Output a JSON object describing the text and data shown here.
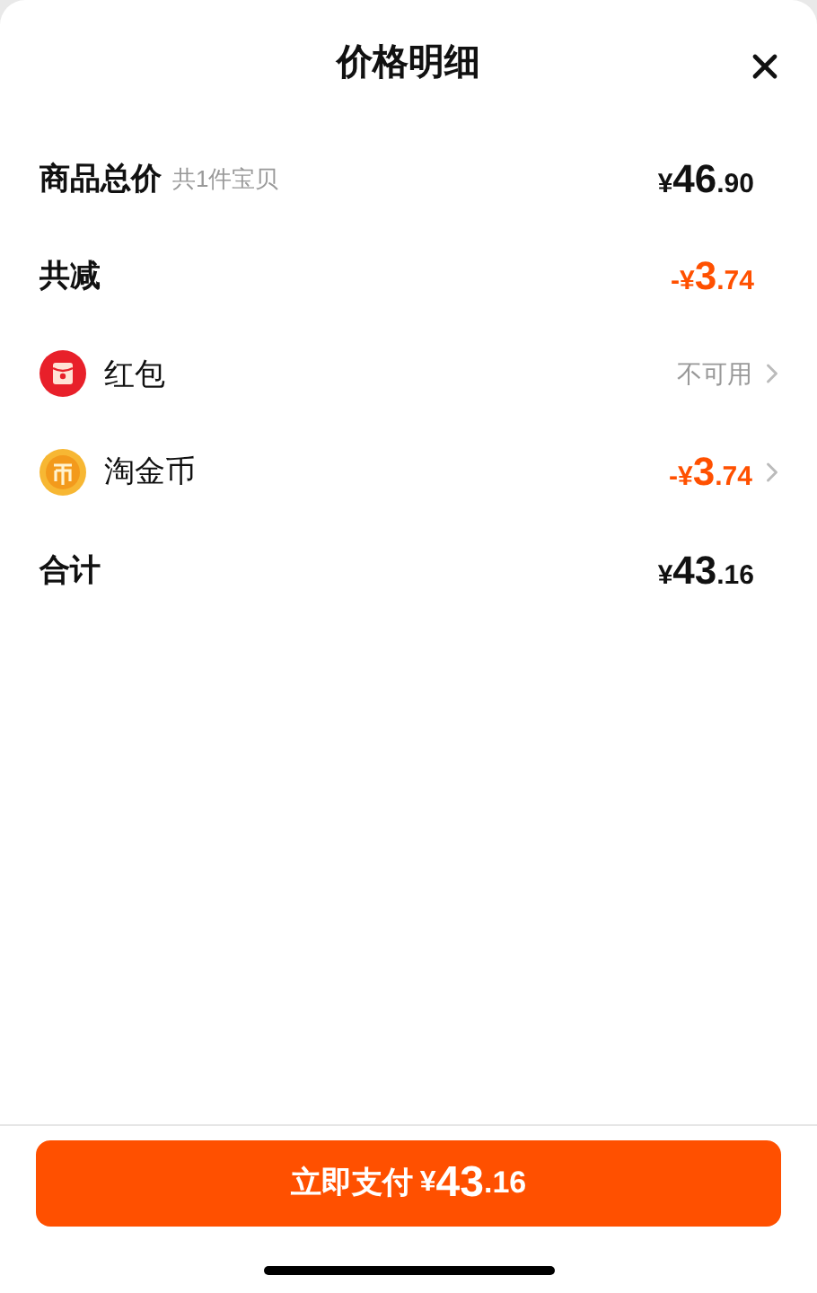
{
  "sheet": {
    "title": "价格明细"
  },
  "rows": [
    {
      "kind": "plain",
      "label": "商品总价",
      "note": "共1件宝贝",
      "amount": {
        "color": "#111111",
        "prefix": "¥",
        "integer": "46",
        "fraction": ".90"
      }
    },
    {
      "kind": "plain",
      "label": "共减",
      "amount": {
        "color": "#ff5000",
        "prefix": "-¥",
        "integer": "3",
        "fraction": ".74"
      }
    },
    {
      "kind": "envelope",
      "label": "红包",
      "status": "不可用"
    },
    {
      "kind": "coin",
      "label": "淘金币",
      "amount": {
        "color": "#ff5000",
        "prefix": "-¥",
        "integer": "3",
        "fraction": ".74"
      }
    },
    {
      "kind": "plain",
      "label": "合计",
      "amount": {
        "color": "#111111",
        "prefix": "¥",
        "integer": "43",
        "fraction": ".16"
      }
    }
  ],
  "pay_button": {
    "label": "立即支付",
    "prefix": "¥",
    "integer": "43",
    "fraction": ".16"
  }
}
